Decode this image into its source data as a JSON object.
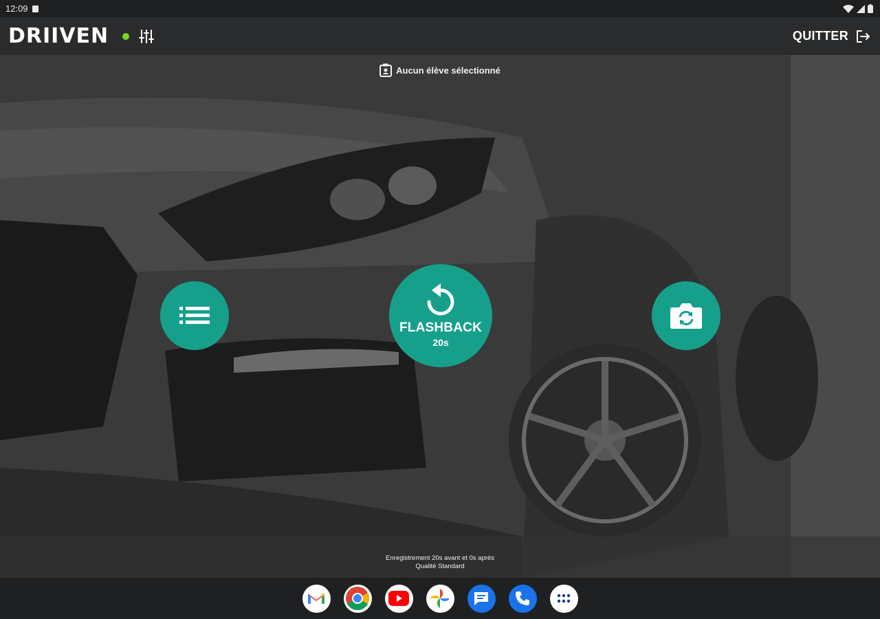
{
  "status_bar": {
    "time": "12:09"
  },
  "app_bar": {
    "logo": "DRIIVEN",
    "quit_label": "QUITTER"
  },
  "main": {
    "student_label": "Aucun élève sélectionné",
    "flashback": {
      "title": "FLASHBACK",
      "duration": "20s"
    },
    "recording_info": {
      "line1": "Enregistrement 20s avant et 0s après",
      "line2": "Qualité Standard"
    }
  },
  "colors": {
    "accent": "#16a08c",
    "online": "#7ed321",
    "app_bar": "#2a2b2d"
  },
  "dock": {
    "apps": [
      "gmail-icon",
      "chrome-icon",
      "youtube-icon",
      "photos-icon",
      "messages-icon",
      "phone-icon",
      "app-drawer-icon"
    ]
  }
}
